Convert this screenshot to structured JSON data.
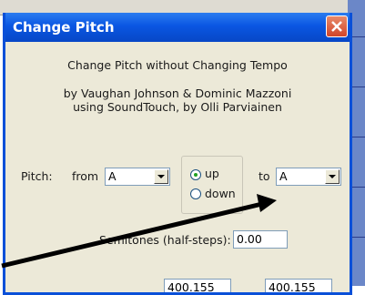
{
  "window": {
    "title": "Change Pitch"
  },
  "header": {
    "heading": "Change Pitch without Changing Tempo",
    "credits_line1": "by Vaughan Johnson & Dominic Mazzoni",
    "credits_line2": "using SoundTouch, by Olli Parviainen"
  },
  "pitch": {
    "label": "Pitch:",
    "from_label": "from",
    "from_value": "A",
    "direction_up_label": "up",
    "direction_down_label": "down",
    "direction_selected": "up",
    "to_label": "to",
    "to_value": "A"
  },
  "semitones": {
    "label": "Semitones (half-steps):",
    "value": "0.00"
  },
  "frequency": {
    "from_value": "400.155",
    "to_value": "400.155"
  }
}
